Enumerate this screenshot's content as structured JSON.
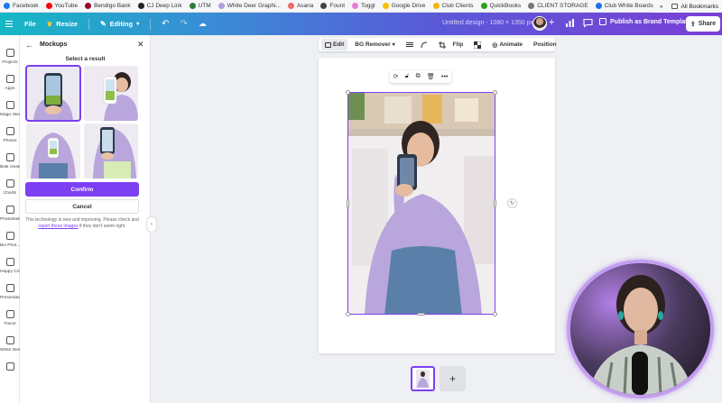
{
  "bookmarks": {
    "items": [
      {
        "label": "Facebook",
        "color": "#1877f2"
      },
      {
        "label": "YouTube",
        "color": "#ff0000"
      },
      {
        "label": "Bendigo Bank",
        "color": "#a0002a"
      },
      {
        "label": "CJ Deep Link",
        "color": "#222222"
      },
      {
        "label": "UTM",
        "color": "#2e7d32"
      },
      {
        "label": "White Deer Graphi...",
        "color": "#b39ddb"
      },
      {
        "label": "Asana",
        "color": "#f06a6a"
      },
      {
        "label": "Fount",
        "color": "#444444"
      },
      {
        "label": "Toggl",
        "color": "#e57cd8"
      },
      {
        "label": "Google Drive",
        "color": "#fbbc04"
      },
      {
        "label": "Club Clients",
        "color": "#f4b400"
      },
      {
        "label": "QuickBooks",
        "color": "#2ca01c"
      },
      {
        "label": "CLIENT STORAGE",
        "color": "#777777"
      },
      {
        "label": "Club White Boards",
        "color": "#1a73e8"
      }
    ],
    "more": "»",
    "all_bookmarks": "All Bookmarks"
  },
  "header": {
    "file": "File",
    "resize": "Resize",
    "editing": "Editing",
    "doc_title": "Untitled design - 1080 × 1350 px",
    "publish": "Publish as Brand Template",
    "share": "Share"
  },
  "rail": {
    "items": [
      "Projects",
      "Apps",
      "Magic Media",
      "Photos",
      "Bulk create",
      "Charts",
      "Photoshelf",
      "Bio Phot...",
      "Happy Crop",
      "Presentatio...",
      "Tracer",
      "White Deer ...",
      ""
    ]
  },
  "panel": {
    "title": "Mockups",
    "select_title": "Select a result",
    "confirm": "Confirm",
    "cancel": "Cancel",
    "note_pre": "This technology is new and improving. Please check and ",
    "note_link": "report these images",
    "note_post": " if they don't seem right."
  },
  "context_toolbar": {
    "edit": "Edit",
    "bg_remover": "BG Remover",
    "flip": "Flip",
    "animate": "Animate",
    "position": "Position"
  },
  "colors": {
    "accent": "#7d3ff2",
    "shirt": "#b8a6dc",
    "jeans": "#5a7fa8"
  }
}
